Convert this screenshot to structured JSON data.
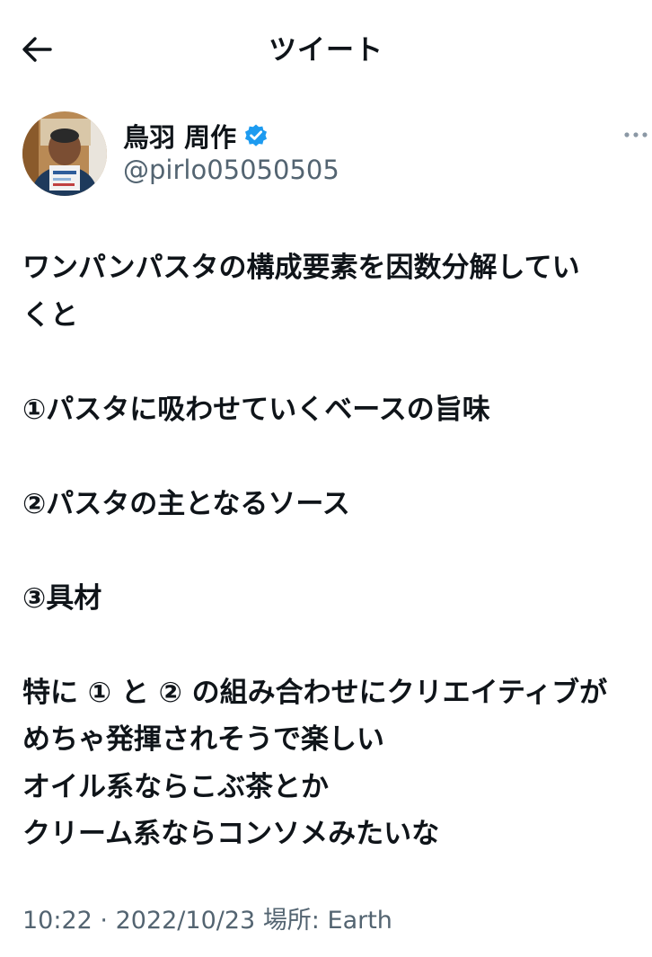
{
  "header": {
    "title": "ツイート"
  },
  "icons": {
    "back": "back-arrow-icon",
    "verified": "verified-badge-icon",
    "more": "more-dots-icon"
  },
  "author": {
    "display_name": "鳥羽 周作",
    "handle": "@pirlo05050505"
  },
  "tweet": {
    "lines": [
      "ワンパンパスタの構成要素を因数分解してい",
      "くと",
      "",
      "①パスタに吸わせていくベースの旨味",
      "",
      "②パスタの主となるソース",
      "",
      "③具材",
      "",
      "特に ① と ② の組み合わせにクリエイティブが",
      "めちゃ発揮されそうで楽しい",
      "オイル系ならこぶ茶とか",
      "クリーム系ならコンソメみたいな"
    ],
    "time": "10:22",
    "separator": "·",
    "date": "2022/10/23",
    "location_label": "場所:",
    "location": "Earth"
  },
  "colors": {
    "text": "#0f1419",
    "secondary": "#536471",
    "verified": "#1d9bf0"
  }
}
